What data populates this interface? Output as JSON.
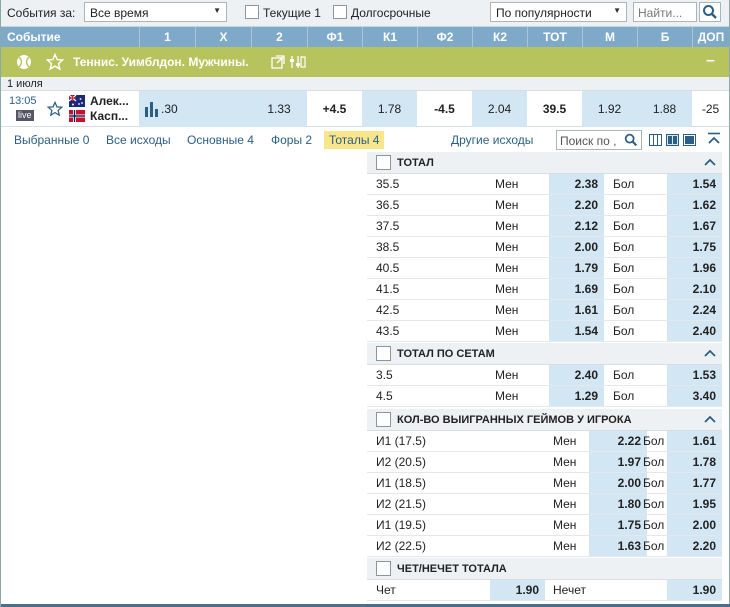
{
  "filters": {
    "events_label": "События за:",
    "period_value": "Все время",
    "current_label": "Текущие 1",
    "longterm_label": "Долгосрочные",
    "sort_value": "По популярности",
    "search_placeholder": "Найти..."
  },
  "columns": [
    "Событие",
    "1",
    "X",
    "2",
    "Ф1",
    "К1",
    "Ф2",
    "К2",
    "ТОТ",
    "М",
    "Б",
    "ДОП"
  ],
  "league": {
    "title": "Теннис. Уимблдон. Мужчины."
  },
  "date": "1 июля",
  "match": {
    "time": "13:05",
    "live_badge": "live",
    "player1": "Алек...",
    "player2": "Касп...",
    "stats_value": ".30",
    "odd_2": "1.33",
    "f1": "+4.5",
    "k1": "1.78",
    "f2": "-4.5",
    "k2": "2.04",
    "tot": "39.5",
    "m": "1.92",
    "b": "1.88",
    "dop": "-25"
  },
  "tabs": [
    "Выбранные 0",
    "Все исходы",
    "Основные 4",
    "Форы 2",
    "Тоталы 4"
  ],
  "other_outcomes": "Другие исходы",
  "market_search_placeholder": "Поиск по ,",
  "markets": {
    "total": {
      "title": "ТОТАЛ",
      "rows": [
        {
          "line": "35.5",
          "under": "Мен",
          "under_odd": "2.38",
          "over": "Бол",
          "over_odd": "1.54"
        },
        {
          "line": "36.5",
          "under": "Мен",
          "under_odd": "2.20",
          "over": "Бол",
          "over_odd": "1.62"
        },
        {
          "line": "37.5",
          "under": "Мен",
          "under_odd": "2.12",
          "over": "Бол",
          "over_odd": "1.67"
        },
        {
          "line": "38.5",
          "under": "Мен",
          "under_odd": "2.00",
          "over": "Бол",
          "over_odd": "1.75"
        },
        {
          "line": "40.5",
          "under": "Мен",
          "under_odd": "1.79",
          "over": "Бол",
          "over_odd": "1.96"
        },
        {
          "line": "41.5",
          "under": "Мен",
          "under_odd": "1.69",
          "over": "Бол",
          "over_odd": "2.10"
        },
        {
          "line": "42.5",
          "under": "Мен",
          "under_odd": "1.61",
          "over": "Бол",
          "over_odd": "2.24"
        },
        {
          "line": "43.5",
          "under": "Мен",
          "under_odd": "1.54",
          "over": "Бол",
          "over_odd": "2.40"
        }
      ]
    },
    "sets": {
      "title": "ТОТАЛ ПО СЕТАМ",
      "rows": [
        {
          "line": "3.5",
          "under": "Мен",
          "under_odd": "2.40",
          "over": "Бол",
          "over_odd": "1.53"
        },
        {
          "line": "4.5",
          "under": "Мен",
          "under_odd": "1.29",
          "over": "Бол",
          "over_odd": "3.40"
        }
      ]
    },
    "games": {
      "title": "КОЛ-ВО ВЫИГРАННЫХ ГЕЙМОВ У ИГРОКА",
      "rows": [
        {
          "line": "И1 (17.5)",
          "under": "Мен",
          "under_odd": "2.22",
          "over": "Бол",
          "over_odd": "1.61"
        },
        {
          "line": "И2 (20.5)",
          "under": "Мен",
          "under_odd": "1.97",
          "over": "Бол",
          "over_odd": "1.78"
        },
        {
          "line": "И1 (18.5)",
          "under": "Мен",
          "under_odd": "2.00",
          "over": "Бол",
          "over_odd": "1.77"
        },
        {
          "line": "И2 (21.5)",
          "under": "Мен",
          "under_odd": "1.80",
          "over": "Бол",
          "over_odd": "1.95"
        },
        {
          "line": "И1 (19.5)",
          "under": "Мен",
          "under_odd": "1.75",
          "over": "Бол",
          "over_odd": "2.00"
        },
        {
          "line": "И2 (22.5)",
          "under": "Мен",
          "under_odd": "1.63",
          "over": "Бол",
          "over_odd": "2.20"
        }
      ]
    },
    "oddeven": {
      "title": "ЧЕТ/НЕЧЕТ ТОТАЛА",
      "rows": [
        {
          "even": "Чет",
          "even_odd": "1.90",
          "odd": "Нечет",
          "odd_odd": "1.90"
        }
      ]
    }
  },
  "colors": {
    "header": "#7fa9c9",
    "league": "#b7c35c",
    "odd_cell": "#d3e6f3",
    "active_tab": "#f9e58a"
  }
}
